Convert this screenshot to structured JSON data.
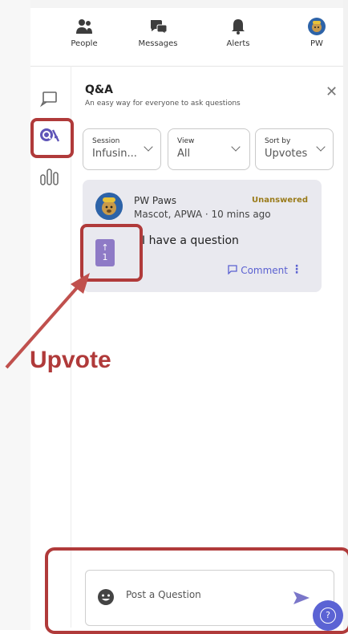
{
  "nav": {
    "items": [
      {
        "label": "People",
        "icon": "people-icon"
      },
      {
        "label": "Messages",
        "icon": "messages-icon"
      },
      {
        "label": "Alerts",
        "icon": "bell-icon"
      },
      {
        "label": "PW",
        "icon": "profile-avatar"
      }
    ]
  },
  "sidebar": {
    "items": [
      {
        "icon": "chat-icon",
        "active": false
      },
      {
        "icon": "qa-icon",
        "active": true
      },
      {
        "icon": "poll-icon",
        "active": false
      }
    ]
  },
  "panel": {
    "title": "Q&A",
    "subtitle": "An easy way for everyone to ask questions",
    "close": "✕"
  },
  "filters": {
    "session": {
      "label": "Session",
      "value": "Infusin..."
    },
    "view": {
      "label": "View",
      "value": "All"
    },
    "sort": {
      "label": "Sort by",
      "value": "Upvotes"
    }
  },
  "question": {
    "author": "PW Paws",
    "meta": "Mascot, APWA · 10 mins ago",
    "status": "Unanswered",
    "text": "I have a question",
    "upvote_arrow": "↑",
    "upvote_count": "1",
    "comment_label": "Comment",
    "more": "⋮"
  },
  "annotation": {
    "label": "Upvote"
  },
  "compose": {
    "placeholder": "Post a Question"
  },
  "help": {
    "label": "?"
  },
  "colors": {
    "accent": "#5b63d4",
    "highlight": "#b03a3a",
    "upvote": "#8e7ac6",
    "status": "#9a7b1a"
  }
}
